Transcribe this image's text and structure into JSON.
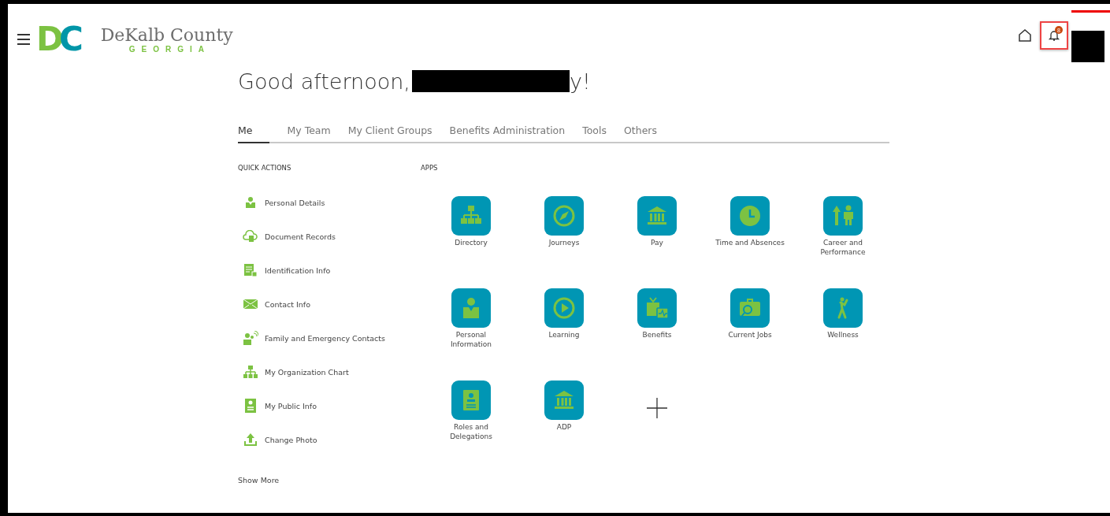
{
  "header": {
    "logo_mark": "DC",
    "logo_title": "DeKalb County",
    "logo_subtitle": "GEORGIA",
    "notification_count": "8"
  },
  "greeting": {
    "text": "Good afternoon,",
    "suffix": "y!"
  },
  "tabs": [
    {
      "label": "Me",
      "selected": true
    },
    {
      "label": "My Team",
      "selected": false
    },
    {
      "label": "My Client Groups",
      "selected": false
    },
    {
      "label": "Benefits Administration",
      "selected": false
    },
    {
      "label": "Tools",
      "selected": false
    },
    {
      "label": "Others",
      "selected": false
    }
  ],
  "quick_actions": {
    "title": "QUICK ACTIONS",
    "items": [
      "Personal Details",
      "Document Records",
      "Identification Info",
      "Contact Info",
      "Family and Emergency Contacts",
      "My Organization Chart",
      "My Public Info",
      "Change Photo"
    ],
    "show_more": "Show More"
  },
  "apps": {
    "title": "APPS",
    "items": [
      "Directory",
      "Journeys",
      "Pay",
      "Time and Absences",
      "Career and Performance",
      "Personal Information",
      "Learning",
      "Benefits",
      "Current Jobs",
      "Wellness",
      "Roles and Delegations",
      "ADP"
    ]
  }
}
